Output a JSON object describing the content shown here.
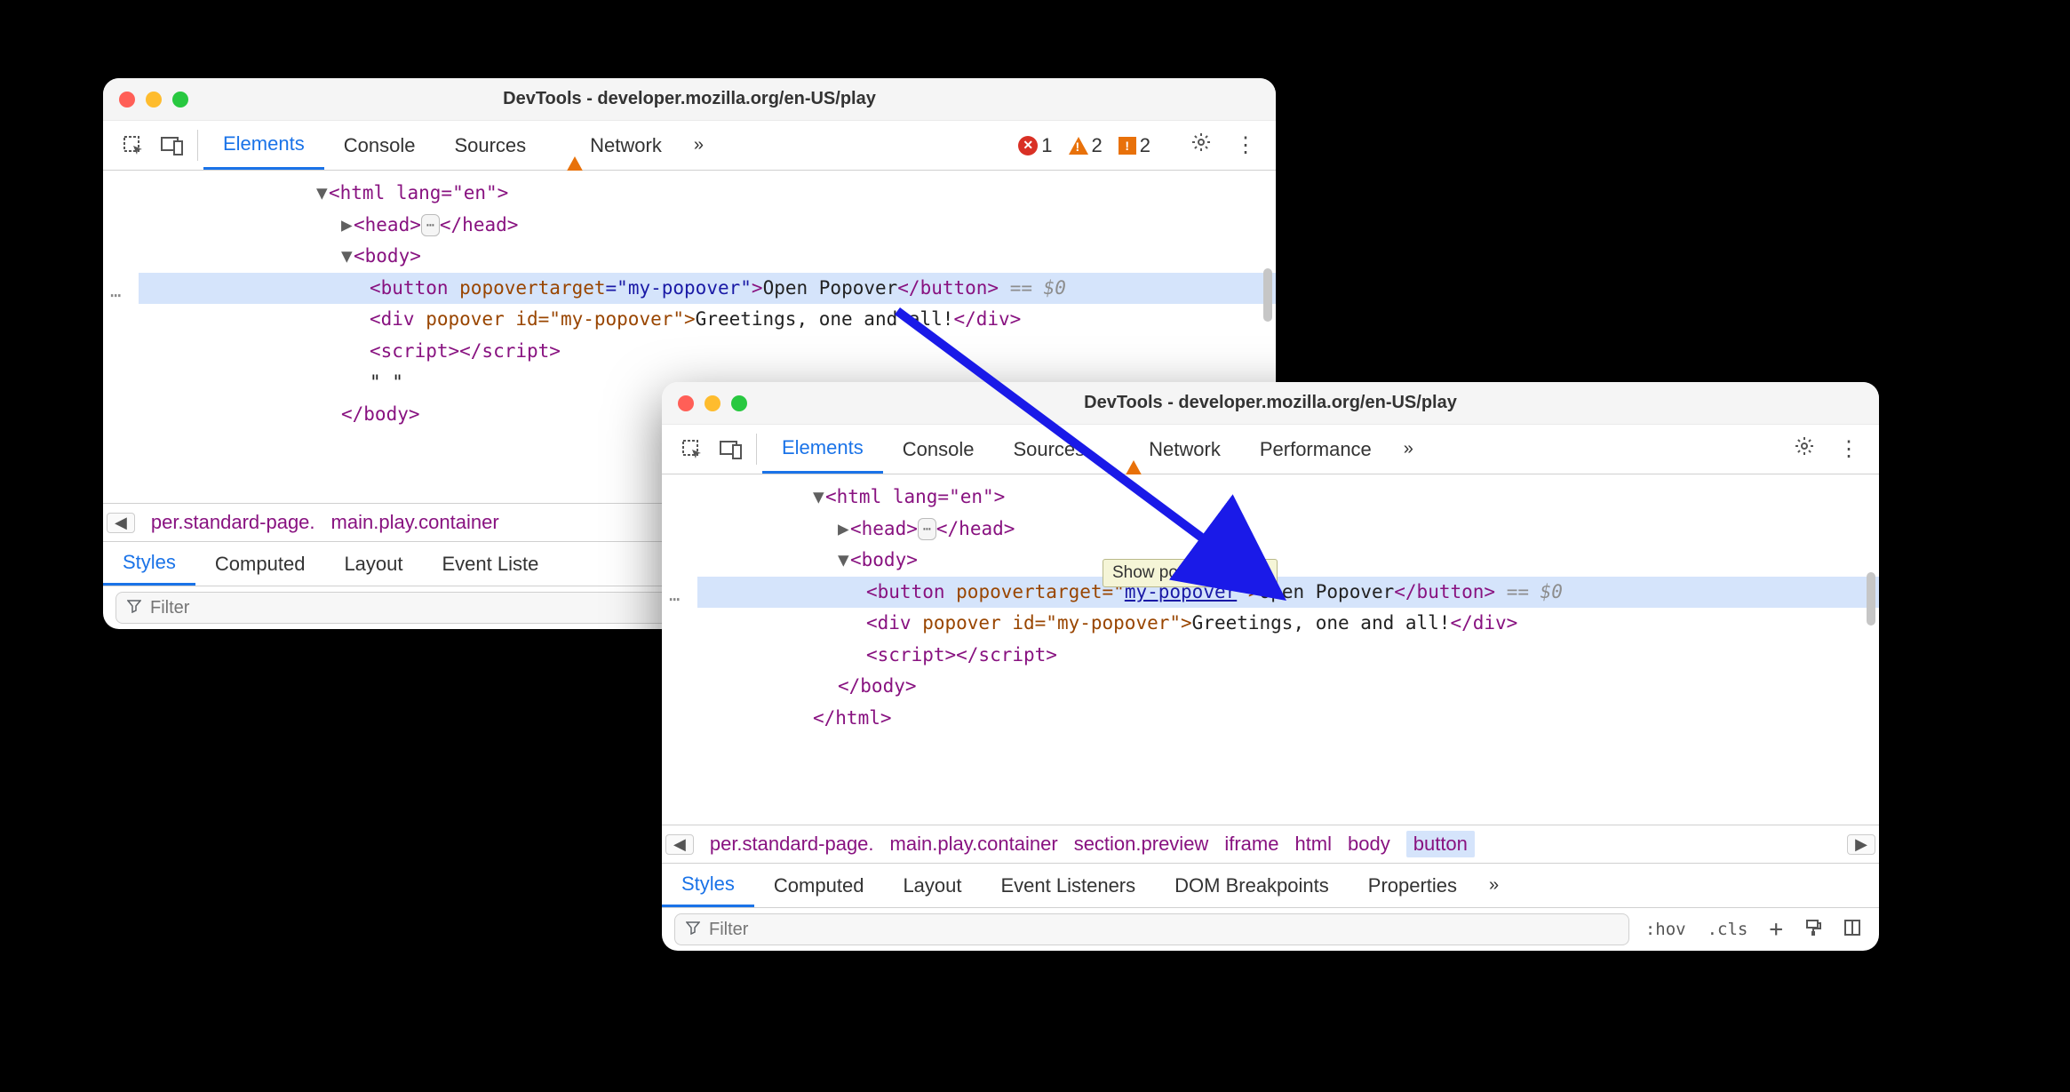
{
  "win1": {
    "title": "DevTools - developer.mozilla.org/en-US/play",
    "tabs": [
      "Elements",
      "Console",
      "Sources",
      "Network"
    ],
    "active_tab": "Elements",
    "badges": {
      "errors": "1",
      "warnings": "2",
      "info": "2"
    },
    "dom": {
      "html_open": "<html lang=\"en\">",
      "head": "<head>",
      "head_close": "</head>",
      "body_open": "<body>",
      "button_tag": "<button",
      "button_attr_n": " popovertarget",
      "button_attr_v": "=\"my-popover\"",
      "button_gt": ">",
      "button_text": "Open Popover",
      "button_close": "</button>",
      "eq0": " == $0",
      "div_line_open": "<div",
      "div_attrs": " popover id=\"my-popover\">",
      "div_text": "Greetings, one and all!",
      "div_close": "</div>",
      "script_line": "<script></script",
      "script_gt": ">",
      "quote_line": "\" \"",
      "body_close": "</body>"
    },
    "breadcrumbs": [
      "per.standard-page.",
      "main.play.container"
    ],
    "subtabs": [
      "Styles",
      "Computed",
      "Layout",
      "Event Liste"
    ],
    "filter_placeholder": "Filter"
  },
  "win2": {
    "title": "DevTools - developer.mozilla.org/en-US/play",
    "tabs": [
      "Elements",
      "Console",
      "Sources",
      "Network",
      "Performance"
    ],
    "active_tab": "Elements",
    "dom": {
      "html_open": "<html lang=\"en\">",
      "head": "<head>",
      "head_close": "</head>",
      "body_open": "<body>",
      "button_tag": "<button",
      "button_attr_n": " popovertarget=\"",
      "button_attr_link": "my-popover",
      "button_attr_tail": "\">",
      "button_text": "Open Popover",
      "button_close": "</button>",
      "eq0": " == $0",
      "div_line_open": "<div",
      "div_attrs": " popover id=\"my-popover\">",
      "div_text": "Greetings, one and all!",
      "div_close": "</div>",
      "script_line": "<script></script",
      "script_gt": ">",
      "body_close": "</body>",
      "html_close": "</html>"
    },
    "tooltip": "Show popover target",
    "breadcrumbs": [
      "per.standard-page.",
      "main.play.container",
      "section.preview",
      "iframe",
      "html",
      "body",
      "button"
    ],
    "breadcrumb_highlight": "button",
    "subtabs": [
      "Styles",
      "Computed",
      "Layout",
      "Event Listeners",
      "DOM Breakpoints",
      "Properties"
    ],
    "filter_placeholder": "Filter",
    "filter_tools": {
      "hov": ":hov",
      "cls": ".cls"
    }
  }
}
